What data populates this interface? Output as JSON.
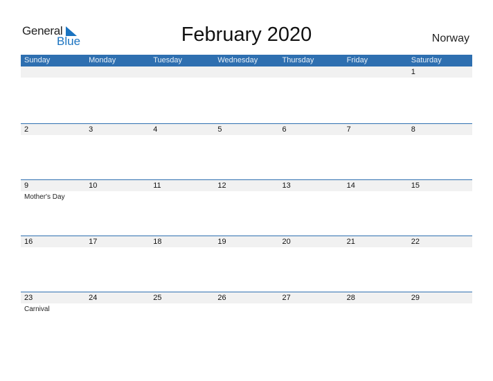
{
  "logo": {
    "line1": "General",
    "line2": "Blue"
  },
  "title": "February 2020",
  "country": "Norway",
  "colors": {
    "header": "#2e6fb0",
    "band": "#f1f1f1",
    "brand": "#1a73c0"
  },
  "days": [
    "Sunday",
    "Monday",
    "Tuesday",
    "Wednesday",
    "Thursday",
    "Friday",
    "Saturday"
  ],
  "weeks": [
    {
      "dates": [
        "",
        "",
        "",
        "",
        "",
        "",
        "1"
      ],
      "events": [
        "",
        "",
        "",
        "",
        "",
        "",
        ""
      ]
    },
    {
      "dates": [
        "2",
        "3",
        "4",
        "5",
        "6",
        "7",
        "8"
      ],
      "events": [
        "",
        "",
        "",
        "",
        "",
        "",
        ""
      ]
    },
    {
      "dates": [
        "9",
        "10",
        "11",
        "12",
        "13",
        "14",
        "15"
      ],
      "events": [
        "Mother's Day",
        "",
        "",
        "",
        "",
        "",
        ""
      ]
    },
    {
      "dates": [
        "16",
        "17",
        "18",
        "19",
        "20",
        "21",
        "22"
      ],
      "events": [
        "",
        "",
        "",
        "",
        "",
        "",
        ""
      ]
    },
    {
      "dates": [
        "23",
        "24",
        "25",
        "26",
        "27",
        "28",
        "29"
      ],
      "events": [
        "Carnival",
        "",
        "",
        "",
        "",
        "",
        ""
      ]
    }
  ]
}
